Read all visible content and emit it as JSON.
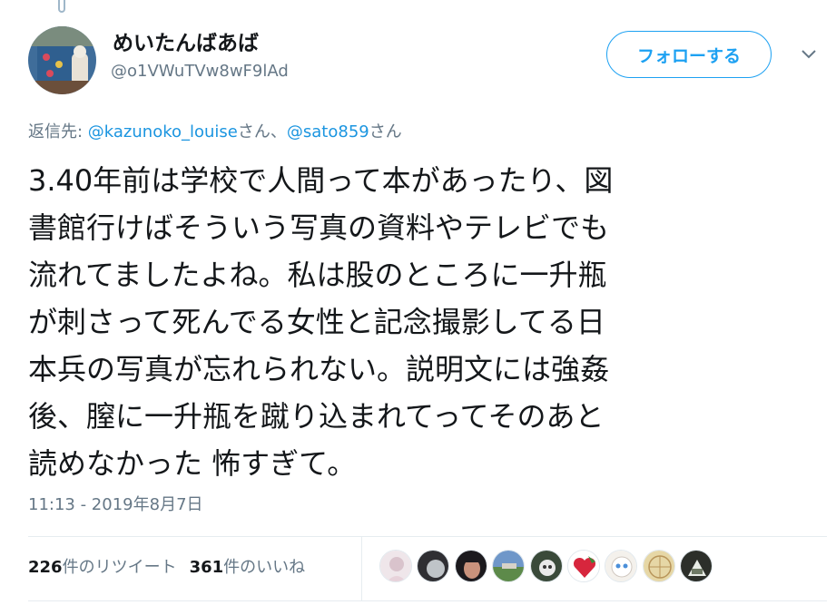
{
  "user": {
    "display_name": "めいたんばあば",
    "handle": "@o1VWuTVw8wF9lAd"
  },
  "follow_button": {
    "label": "フォローする"
  },
  "reply": {
    "prefix": "返信先: ",
    "mention1": "@kazunoko_louise",
    "suffix1": "さん、",
    "mention2": "@sato859",
    "suffix2": "さん"
  },
  "tweet": {
    "lines": [
      "3.40年前は学校で人間って本があったり、図",
      "書館行けばそういう写真の資料やテレビでも",
      "流れてましたよね。私は股のところに一升瓶",
      "が刺さって死んでる女性と記念撮影してる日",
      "本兵の写真が忘れられない。説明文には強姦",
      "後、膣に一升瓶を蹴り込まれてってそのあと",
      "読めなかった 怖すぎて。"
    ],
    "timestamp": "11:13 - 2019年8月7日"
  },
  "stats": {
    "retweet_count": "226",
    "retweet_label": "件のリツイート",
    "like_count": "361",
    "like_label": "件のいいね"
  },
  "colors": {
    "accent": "#1da1f2",
    "mention": "#1b95e0",
    "secondary_text": "#657786"
  },
  "likers": [
    "avatar-1",
    "avatar-2",
    "avatar-3",
    "avatar-4",
    "avatar-5",
    "avatar-6",
    "avatar-7",
    "avatar-8",
    "avatar-9"
  ]
}
